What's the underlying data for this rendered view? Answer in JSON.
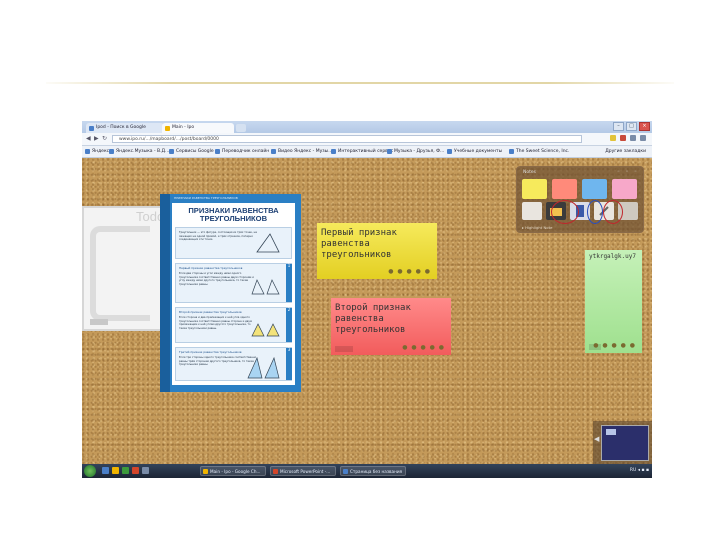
{
  "browser": {
    "tabs": [
      {
        "label": "Ipod - Поиск в Google",
        "color": "#4a7fc8"
      },
      {
        "label": "Main - Ipo",
        "color": "#f0b400"
      }
    ],
    "url": "www.ipo.ru/.../mapboard/.../post/board/0000",
    "bookmarks": [
      "Яндекс",
      "Яндекс.Музыка - В.Д...",
      "Сервисы Google",
      "Переводчик онлайн",
      "Видео Яндекс - Музы...",
      "Интерактивный сервис",
      "Музыка - Друзья, Ф...",
      "Учебные документы",
      "The Sweet Science, Inc."
    ],
    "bookmarks_folder": "Другие закладки"
  },
  "board": {
    "todo_title": "Todo",
    "poster": {
      "top_text": "ПРИЗНАКИ РАВЕНСТВА ТРЕУГОЛЬНИКОВ",
      "title": "ПРИЗНАКИ РАВЕНСТВА ТРЕУГОЛЬНИКОВ",
      "sections": [
        {
          "head": "",
          "text": "Треугольник — это фигура, состоящая из трёх точек, не лежащих на одной прямой, и трёх отрезков, попарно соединяющих эти точки.",
          "num": ""
        },
        {
          "head": "Первый признак равенства треугольников",
          "text": "Если две стороны и угол между ними одного треугольника соответственно равны двум сторонам и углу между ними другого треугольника, то такие треугольники равны.",
          "num": "1"
        },
        {
          "head": "Второй признак равенства треугольников",
          "text": "Если сторона и два прилежащих к ней угла одного треугольника соответственно равны стороне и двум прилежащим к ней углам другого треугольника, то такие треугольники равны.",
          "num": "2"
        },
        {
          "head": "Третий признак равенства треугольников",
          "text": "Если три стороны одного треугольника соответственно равны трём сторонам другого треугольника, то такие треугольники равны.",
          "num": "3"
        }
      ]
    },
    "note_yellow": "Первый признак\nравенства\nтреугольников",
    "note_red": "Второй признак\nравенства\nтреугольников",
    "note_green": "ytkrgalgk.uy7",
    "note_dots": "● ● ● ● ●",
    "palette": {
      "header": "Notes",
      "controls": "◦ ◦ ◦",
      "colors": [
        "#f6ea5c",
        "#ff8a7a",
        "#6fb6ee",
        "#f7a8c9"
      ],
      "footer": "▸ Highlight Note"
    }
  },
  "taskbar": {
    "items": [
      {
        "label": "Main - Ipo - Google Ch...",
        "color": "#f0b400"
      },
      {
        "label": "Microsoft PowerPoint -...",
        "color": "#d2452a"
      },
      {
        "label": "Страница без названия",
        "color": "#4a7fc8"
      }
    ],
    "tray": "RU ◂ ▪ ▪"
  }
}
